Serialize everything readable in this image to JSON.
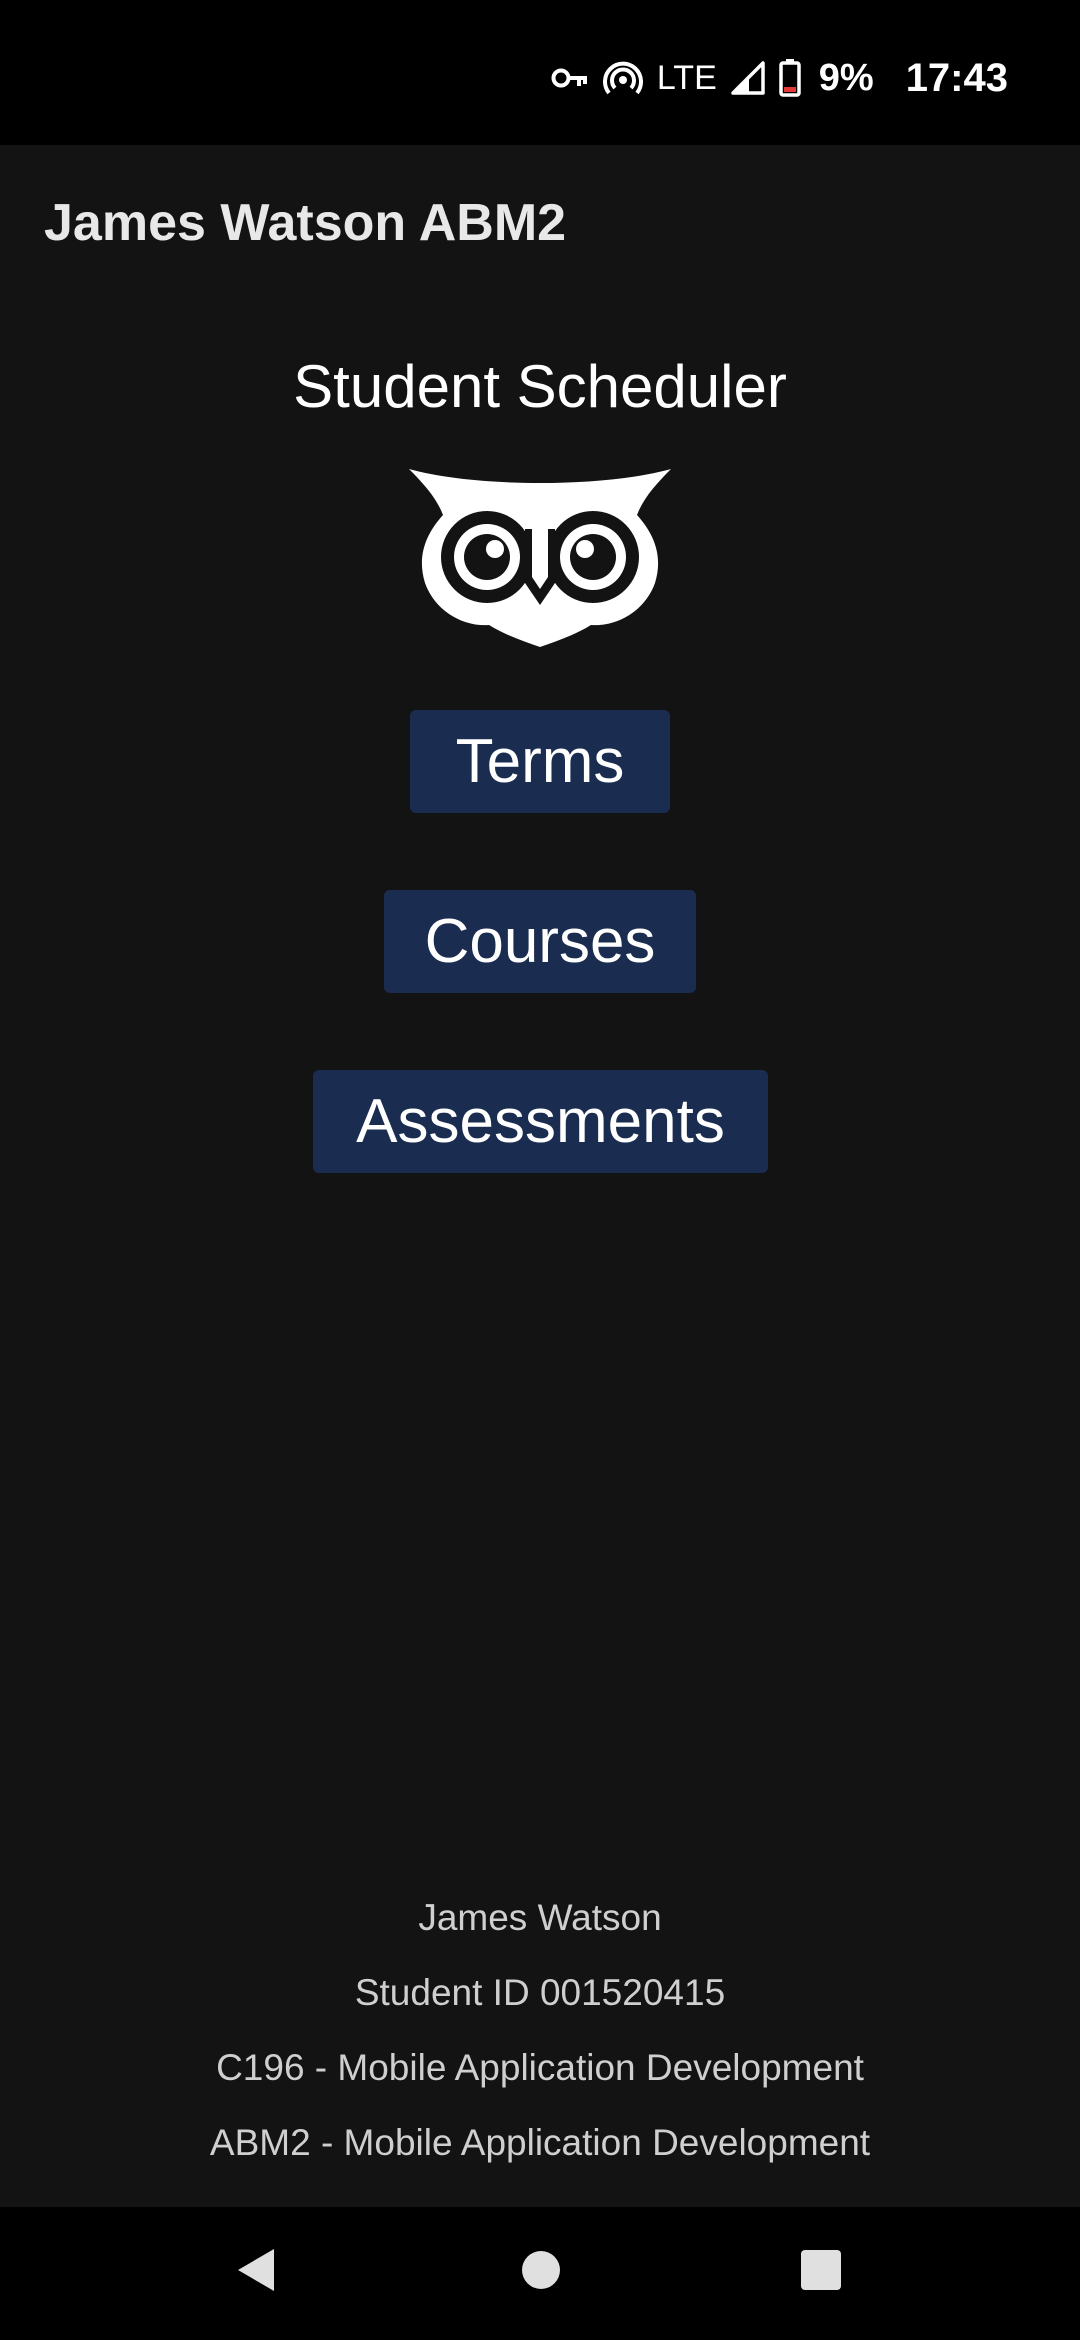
{
  "status_bar": {
    "icons": [
      "vpn-key-icon",
      "hotspot-icon",
      "signal-icon",
      "battery-icon"
    ],
    "network": "LTE",
    "battery": "9%",
    "time": "17:43"
  },
  "app_bar": {
    "title": "James Watson ABM2"
  },
  "main": {
    "heading": "Student Scheduler",
    "logo_icon": "owl-logo-icon",
    "buttons": {
      "terms": "Terms",
      "courses": "Courses",
      "assessments": "Assessments"
    }
  },
  "footer": {
    "lines": [
      "James Watson",
      "Student ID 001520415",
      "C196 - Mobile Application Development",
      "ABM2 - Mobile Application Development"
    ]
  },
  "nav_bar": {
    "icons": [
      "back-icon",
      "home-icon",
      "recents-icon"
    ]
  },
  "colors": {
    "background": "#131313",
    "button": "#1a2d50",
    "bars": "#000000"
  }
}
